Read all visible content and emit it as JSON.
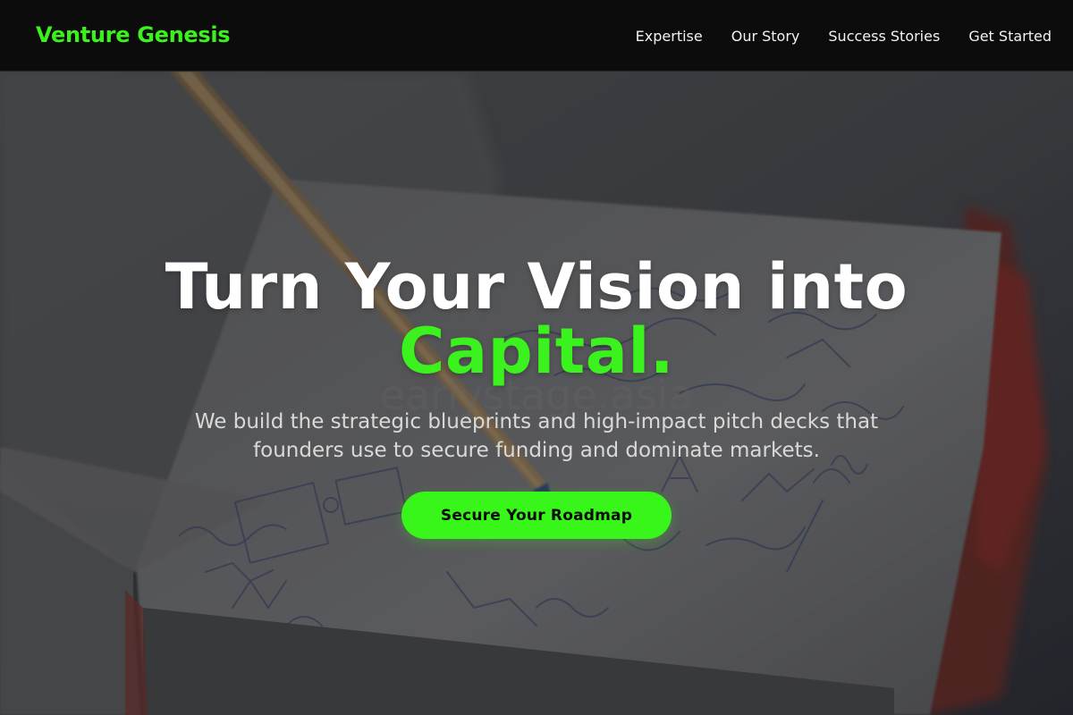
{
  "header": {
    "brand": "Venture Genesis",
    "nav": [
      {
        "label": "Expertise"
      },
      {
        "label": "Our Story"
      },
      {
        "label": "Success Stories"
      },
      {
        "label": "Get Started"
      }
    ]
  },
  "hero": {
    "headline_main": "Turn Your Vision into",
    "headline_accent": "Capital.",
    "subtext": "We build the strategic blueprints and high-impact pitch decks that founders use to secure funding and dominate markets.",
    "cta_label": "Secure Your Roadmap",
    "background_watermark": "earlystage.asia"
  },
  "colors": {
    "accent": "#3cf21e",
    "header_bg": "#0c0c0c",
    "headline": "#ffffff",
    "subtext": "#d9d9d9",
    "cta_text": "#0a0a0a"
  }
}
